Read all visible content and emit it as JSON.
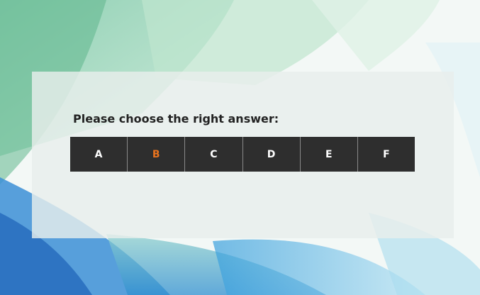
{
  "quiz": {
    "prompt": "Please choose the right answer:",
    "options": [
      {
        "label": "A",
        "selected": false
      },
      {
        "label": "B",
        "selected": true
      },
      {
        "label": "C",
        "selected": false
      },
      {
        "label": "D",
        "selected": false
      },
      {
        "label": "E",
        "selected": false
      },
      {
        "label": "F",
        "selected": false
      }
    ]
  },
  "colors": {
    "selected_option": "#e8731e",
    "option_background": "#2e2e2e",
    "option_text": "#ffffff",
    "prompt_text": "#222222"
  }
}
